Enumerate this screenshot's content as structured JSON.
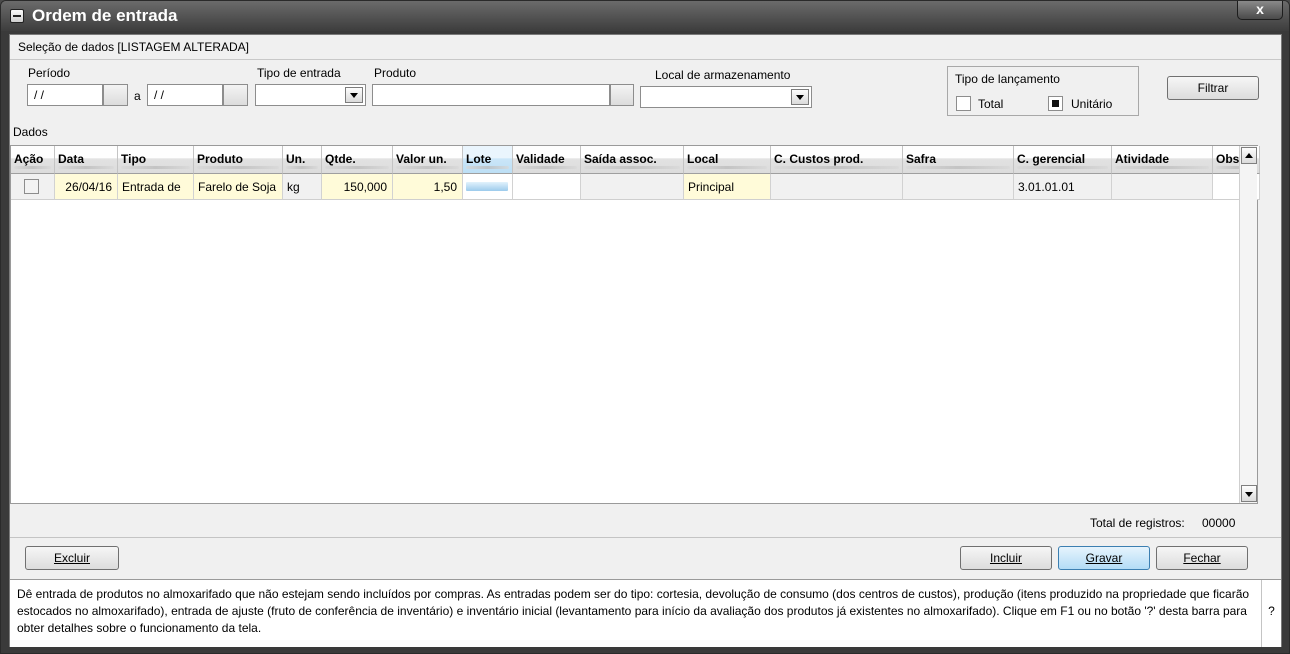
{
  "window": {
    "title": "Ordem de entrada",
    "close_label": "x"
  },
  "selection": {
    "title": "Seleção de dados [LISTAGEM ALTERADA]",
    "periodo_label": "Período",
    "date_from": " / /",
    "date_sep": "a",
    "date_to": " / /",
    "tipo_entrada_label": "Tipo de entrada",
    "tipo_entrada_value": "",
    "produto_label": "Produto",
    "produto_value": "",
    "local_label": "Local de armazenamento",
    "local_value": "",
    "tipo_lancamento_label": "Tipo de lançamento",
    "total_label": "Total",
    "total_checked": false,
    "unitario_label": "Unitário",
    "unitario_checked": true,
    "filtrar_label": "Filtrar"
  },
  "dados_label": "Dados",
  "grid": {
    "columns": [
      "Ação",
      "Data",
      "Tipo",
      "Produto",
      "Un.",
      "Qtde.",
      "Valor un.",
      "Lote",
      "Validade",
      "Saída assoc.",
      "Local",
      "C. Custos prod.",
      "Safra",
      "C. gerencial",
      "Atividade",
      "Obs."
    ],
    "rows": [
      {
        "acao": "",
        "data": "26/04/16",
        "tipo": "Entrada de",
        "produto": "Farelo de Soja",
        "un": "kg",
        "qtde": "150,000",
        "valor_un": "1,50",
        "lote": "",
        "validade": "",
        "saida_assoc": "",
        "local": "Principal",
        "c_custos_prod": "",
        "safra": "",
        "c_gerencial": "3.01.01.01",
        "atividade": "",
        "obs": ""
      }
    ]
  },
  "total_registros_label": "Total de registros:",
  "total_registros_value": "00000",
  "buttons": {
    "excluir": "Excluir",
    "incluir": "Incluir",
    "gravar": "Gravar",
    "fechar": "Fechar"
  },
  "info_text": "Dê entrada de produtos no almoxarifado que não estejam sendo incluídos por compras. As entradas podem ser do tipo: cortesia, devolução de consumo (dos centros de custos), produção (itens produzido na propriedade que ficarão estocados no almoxarifado), entrada de ajuste (fruto de conferência de inventário) e inventário inicial (levantamento para início da avaliação dos produtos já existentes no almoxarifado). Clique em F1 ou no botão '?' desta barra para obter detalhes sobre o funcionamento da tela.",
  "help_label": "?"
}
